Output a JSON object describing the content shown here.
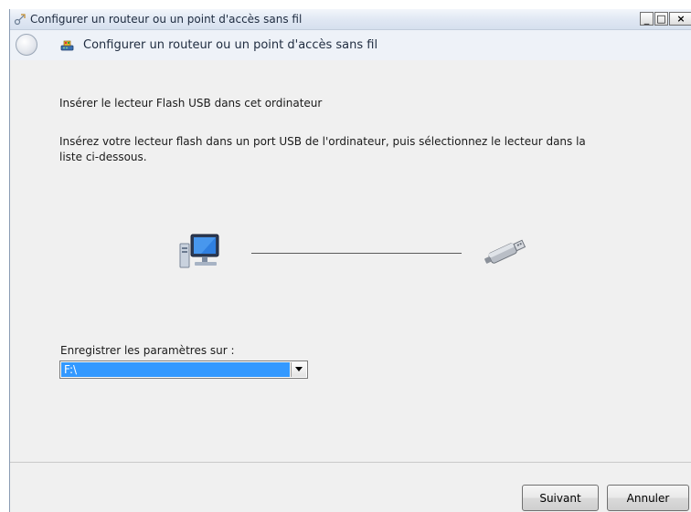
{
  "window": {
    "title": "Configurer un routeur ou un point d'accès sans fil",
    "controls": {
      "minimize": "_",
      "maximize": "□",
      "close": "×"
    }
  },
  "header": {
    "title": "Configurer un routeur ou un point d'accès sans fil"
  },
  "content": {
    "heading": "Insérer le lecteur Flash USB dans cet ordinateur",
    "instructions": "Insérez votre lecteur flash dans un port USB de l'ordinateur, puis sélectionnez le lecteur dans la liste ci-dessous.",
    "save_label": "Enregistrer les paramètres sur :",
    "drive_select": {
      "selected": "F:\\"
    }
  },
  "footer": {
    "next_label": "Suivant",
    "cancel_label": "Annuler"
  },
  "colors": {
    "selection": "#3399ff",
    "window_bg": "#f0f0f0",
    "title_text": "#1e2b3f"
  },
  "icons": [
    "network-setup-icon",
    "back-arrow-icon",
    "wireless-router-icon",
    "computer-icon",
    "usb-drive-icon",
    "chevron-down-icon"
  ]
}
